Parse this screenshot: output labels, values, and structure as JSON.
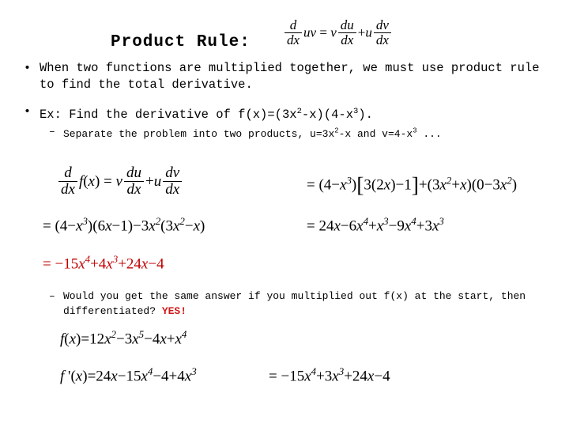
{
  "slide": {
    "title": "Product Rule:",
    "title_formula": "d/dx uv = v du/dx + u dv/dx",
    "bullets": [
      {
        "level": 1,
        "marker": "•",
        "text": "When two functions are multiplied together, we must use product rule to find the total derivative."
      },
      {
        "level": 1,
        "marker": "•",
        "text": "Ex: Find the derivative of f(x)=(3x2-x)(4-x3)."
      },
      {
        "level": 2,
        "marker": "–",
        "text": "Separate the problem into two products, u=3x2-x and v=4-x3 ..."
      },
      {
        "level": 2,
        "marker": "–",
        "text_before": "Would you get the same answer if you multiplied out f(x) at the start, then differentiated?",
        "highlight": "YES!",
        "highlight_color": "#d01818"
      }
    ],
    "equations": {
      "eq1": "d/dx f(x) = v du/dx + u dv/dx",
      "eq2": "= (4 - x3)[3(2x) - 1] + (3x2 + x)(0 - 3x2)",
      "eq3": "= (4 - x3)(6x - 1) - 3x2(3x2 - x)",
      "eq4": "= 24x - 6x4 + x3 - 9x4 + 3x3",
      "eq5": "= -15x4 + 4x3 + 24x - 4",
      "eq6": "f(x) = 12x2 - 3x5 - 4x + x4",
      "eq7": "f '(x) = 24x - 15x4 - 4 + 4x3",
      "eq8": "= -15x4 + 3x3 + 24x - 4"
    },
    "colors": {
      "text": "#000000",
      "highlight_red": "#d01818",
      "equation_red": "#c00000",
      "background": "#ffffff"
    }
  }
}
